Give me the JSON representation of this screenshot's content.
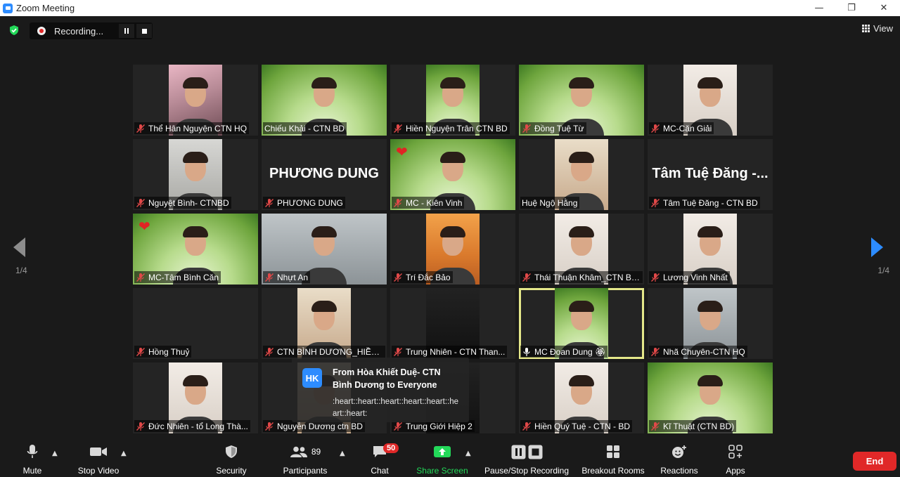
{
  "window": {
    "title": "Zoom Meeting"
  },
  "recording": {
    "label": "Recording..."
  },
  "view": {
    "label": "View"
  },
  "pagination": {
    "left": "1/4",
    "right": "1/4"
  },
  "participants_grid": [
    {
      "name": "Thể Hân Nguyện CTN HQ",
      "muted": true,
      "bg": "pink"
    },
    {
      "name": "Chiếu Khải - CTN BD",
      "muted": false,
      "bg": "bamboo-wide"
    },
    {
      "name": "Hiền Nguyện Trân CTN BD",
      "muted": true,
      "bg": "bamboo"
    },
    {
      "name": "Đồng Tuệ Từ",
      "muted": true,
      "bg": "bamboo-wide"
    },
    {
      "name": "MC-Căn Giải",
      "muted": true,
      "bg": "cream"
    },
    {
      "name": "Nguyệt Bình- CTNBD",
      "muted": true,
      "bg": "grey"
    },
    {
      "name": "PHƯƠNG DUNG",
      "muted": true,
      "bg": "none",
      "display_name": "PHƯƠNG DUNG"
    },
    {
      "name": "MC - Kiên Vinh",
      "muted": true,
      "bg": "bamboo-wide",
      "heart": true
    },
    {
      "name": "Huệ Ngộ Hằng",
      "muted": false,
      "bg": "warm"
    },
    {
      "name": "Tâm Tuệ Đăng - CTN BD",
      "muted": true,
      "bg": "none",
      "display_name": "Tâm Tuệ Đăng -..."
    },
    {
      "name": "MC-Tâm Bình Căn",
      "muted": true,
      "bg": "bamboo-wide",
      "heart": true
    },
    {
      "name": "Nhựt An",
      "muted": true,
      "bg": "stone-wide"
    },
    {
      "name": "Trí Đắc Bảo",
      "muted": true,
      "bg": "orange"
    },
    {
      "name": "Thái Thuận Khâm_CTN Bì...",
      "muted": true,
      "bg": "cream"
    },
    {
      "name": "Lương Vinh Nhất",
      "muted": true,
      "bg": "cream"
    },
    {
      "name": "Hồng Thuỷ",
      "muted": true,
      "bg": "none"
    },
    {
      "name": "CTN BÌNH DƯƠNG_HIỀN ...",
      "muted": true,
      "bg": "warm"
    },
    {
      "name": "Trung Nhiên - CTN Than...",
      "muted": true,
      "bg": "dark"
    },
    {
      "name": "MC Đoan Dung 🏵",
      "muted": false,
      "speaking": true,
      "bg": "bamboo",
      "active": true
    },
    {
      "name": "Nhã Chuyên-CTN HQ",
      "muted": true,
      "bg": "stone"
    },
    {
      "name": "Đức Nhiên - tổ Long Thà...",
      "muted": true,
      "bg": "cream"
    },
    {
      "name": "Nguyễn Dương ctn BD",
      "muted": true,
      "bg": "warm"
    },
    {
      "name": "Trung Giới Hiệp 2",
      "muted": true,
      "bg": "dark"
    },
    {
      "name": "Hiền Quý Tuệ - CTN - BD",
      "muted": true,
      "bg": "cream"
    },
    {
      "name": "Kĩ Thuật (CTN BD)",
      "muted": true,
      "bg": "bamboo-wide"
    }
  ],
  "chat_toast": {
    "avatar": "HK",
    "from": "From Hòa Khiết Duệ- CTN Bình Dương to Everyone",
    "message": ":heart::heart::heart::heart::heart::heart::heart:"
  },
  "toolbar": {
    "mute": "Mute",
    "stop_video": "Stop Video",
    "security": "Security",
    "participants": "Participants",
    "participants_count": "89",
    "chat": "Chat",
    "chat_badge": "50",
    "share_screen": "Share Screen",
    "pause_stop_recording": "Pause/Stop Recording",
    "breakout_rooms": "Breakout Rooms",
    "reactions": "Reactions",
    "apps": "Apps",
    "end": "End"
  },
  "colors": {
    "accent_blue": "#2d8cff",
    "share_green": "#23d959",
    "end_red": "#e02828",
    "active_speaker": "#e5e88a"
  }
}
